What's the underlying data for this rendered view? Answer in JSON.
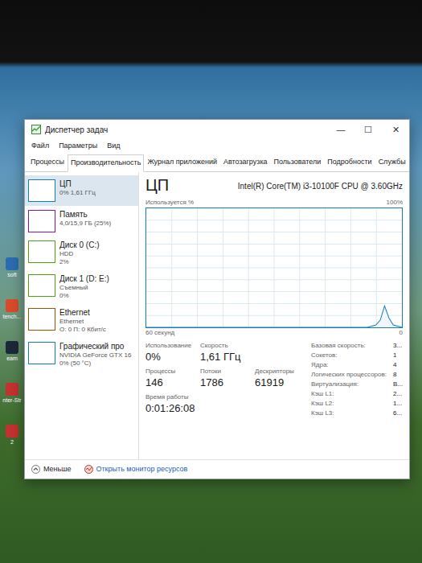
{
  "window": {
    "title": "Диспетчер задач",
    "controls": [
      "—",
      "☐",
      "✕"
    ]
  },
  "menu": [
    "Файл",
    "Параметры",
    "Вид"
  ],
  "tabs": [
    {
      "label": "Процессы",
      "selected": false
    },
    {
      "label": "Производительность",
      "selected": true
    },
    {
      "label": "Журнал приложений",
      "selected": false
    },
    {
      "label": "Автозагрузка",
      "selected": false
    },
    {
      "label": "Пользователи",
      "selected": false
    },
    {
      "label": "Подробности",
      "selected": false
    },
    {
      "label": "Службы",
      "selected": false
    }
  ],
  "sidebar": {
    "items": [
      {
        "name": "ЦП",
        "lines": [
          "0% 1,61 ГГц"
        ],
        "selected": true,
        "color": "#117dbb"
      },
      {
        "name": "Память",
        "lines": [
          "4,0/15,9 ГБ (25%)"
        ],
        "selected": false,
        "color": "#8b12ae"
      },
      {
        "name": "Диск 0 (C:)",
        "lines": [
          "HDD",
          "2%"
        ],
        "selected": false,
        "color": "#4da60c"
      },
      {
        "name": "Диск 1 (D: E:)",
        "lines": [
          "Съемный",
          "0%"
        ],
        "selected": false,
        "color": "#4da60c"
      },
      {
        "name": "Ethernet",
        "lines": [
          "Ethernet",
          "О: 0 П: 0 Кбит/с"
        ],
        "selected": false,
        "color": "#a74f01"
      },
      {
        "name": "Графический про",
        "lines": [
          "NVIDIA GeForce GTX 16",
          "0% (50 °C)"
        ],
        "selected": false,
        "color": "#117dbb"
      }
    ]
  },
  "main": {
    "title": "ЦП",
    "cpu_name": "Intel(R) Core(TM) i3-10100F CPU @ 3.60GHz",
    "chart": {
      "y_label": "Используется %",
      "y_max": "100%",
      "x_label": "60 секунд",
      "y_min": "0",
      "values": [
        0,
        0,
        0,
        0,
        0,
        0,
        0,
        0,
        0,
        0,
        0,
        0,
        0,
        0,
        0,
        0,
        0,
        0,
        0,
        0,
        0,
        0,
        0,
        0,
        0,
        0,
        0,
        0,
        0,
        0,
        0,
        0,
        0,
        0,
        0,
        0,
        0,
        0,
        0,
        0,
        0,
        0,
        0,
        0,
        0,
        0,
        0,
        0,
        0,
        0,
        0,
        0,
        1,
        2,
        6,
        18,
        8,
        2,
        1,
        0
      ]
    },
    "stats_rows": [
      [
        {
          "label": "Использование",
          "value": "0%"
        },
        {
          "label": "Скорость",
          "value": "1,61 ГГц"
        }
      ],
      [
        {
          "label": "Процессы",
          "value": "146"
        },
        {
          "label": "Потоки",
          "value": "1786"
        },
        {
          "label": "Дескрипторы",
          "value": "61919"
        }
      ],
      [
        {
          "label": "Время работы",
          "value": "0:01:26:08"
        }
      ]
    ],
    "details": [
      {
        "label": "Базовая скорость:",
        "value": "3..."
      },
      {
        "label": "Сокетов:",
        "value": "1"
      },
      {
        "label": "Ядра:",
        "value": "4"
      },
      {
        "label": "Логических процессоров:",
        "value": "8"
      },
      {
        "label": "Виртуализация:",
        "value": "В..."
      },
      {
        "label": "Кэш L1:",
        "value": "2..."
      },
      {
        "label": "Кэш L2:",
        "value": "1..."
      },
      {
        "label": "Кэш L3:",
        "value": "6..."
      }
    ]
  },
  "footer": {
    "less": "Меньше",
    "monitor": "Открыть монитор ресурсов"
  },
  "desktop_icons": [
    {
      "label": "soft",
      "color": "#2b6cb0"
    },
    {
      "label": "tench...",
      "color": "#d94a2b"
    },
    {
      "label": "eam",
      "color": "#1b2838"
    },
    {
      "label": "nter-Str",
      "color": "#c53030"
    },
    {
      "label": "2",
      "color": "#c53030"
    }
  ]
}
